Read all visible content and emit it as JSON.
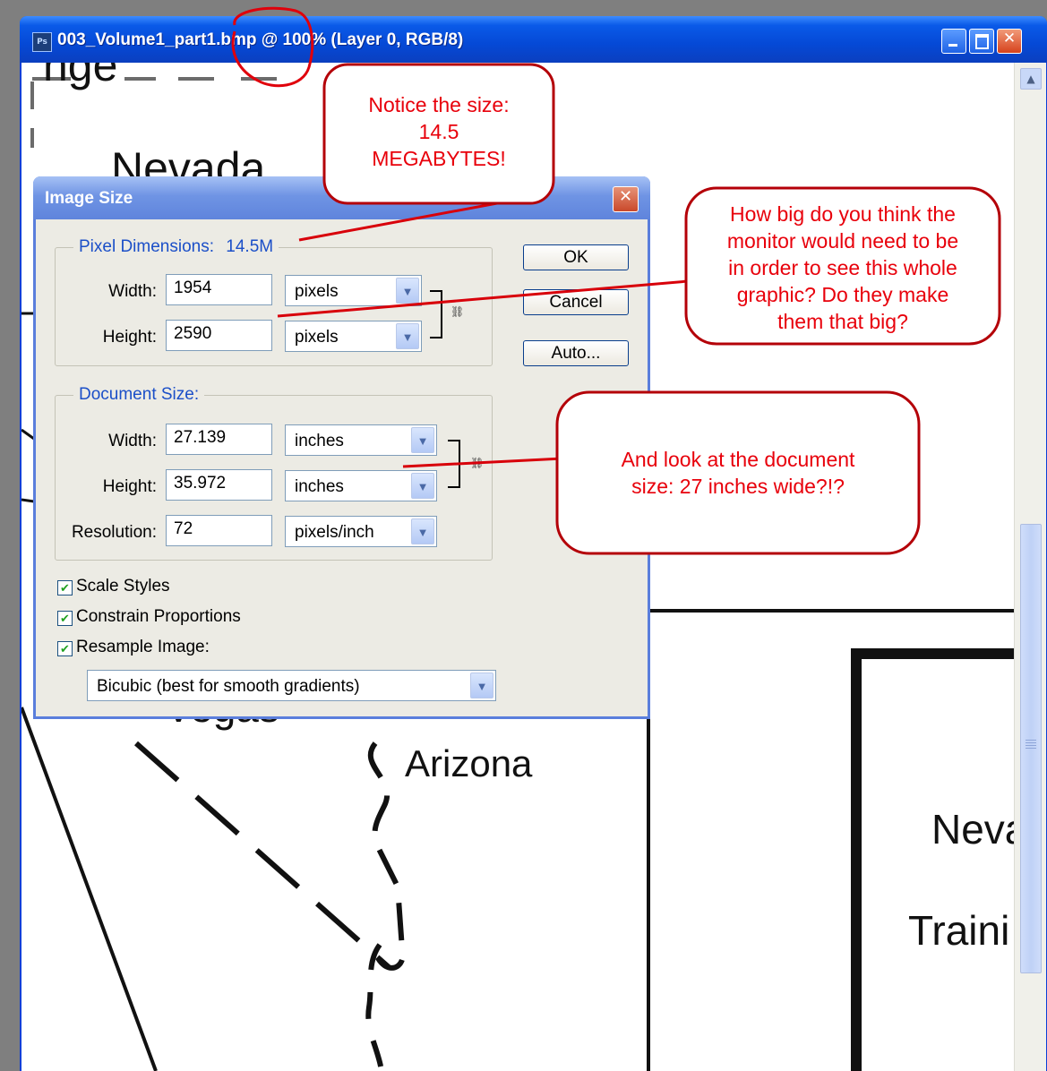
{
  "window": {
    "title": "003_Volume1_part1.bmp @ 100% (Layer 0, RGB/8)",
    "app_icon": "Ps",
    "controls": [
      "minimize",
      "maximize",
      "close"
    ],
    "colors": {
      "titlebar": "#0549d6",
      "canvas": "#ffffff"
    }
  },
  "map": {
    "labels": {
      "top_fragment": "nge",
      "nevada": "Nevada",
      "vegas_fragment": "Vegas",
      "arizona": "Arizona",
      "right_nevada": "Neva",
      "right_training": "Traini"
    }
  },
  "dialog": {
    "title": "Image Size",
    "pixel_dimensions": {
      "legend": "Pixel Dimensions:",
      "size": "14.5M",
      "width_label": "Width:",
      "width_value": "1954",
      "width_unit": "pixels",
      "height_label": "Height:",
      "height_value": "2590",
      "height_unit": "pixels"
    },
    "document_size": {
      "legend": "Document Size:",
      "width_label": "Width:",
      "width_value": "27.139",
      "width_unit": "inches",
      "height_label": "Height:",
      "height_value": "35.972",
      "height_unit": "inches",
      "resolution_label": "Resolution:",
      "resolution_value": "72",
      "resolution_unit": "pixels/inch"
    },
    "buttons": {
      "ok": "OK",
      "cancel": "Cancel",
      "auto": "Auto..."
    },
    "checkboxes": {
      "scale_styles": {
        "label": "Scale Styles",
        "checked": true
      },
      "constrain": {
        "label": "Constrain Proportions",
        "checked": true
      },
      "resample": {
        "label": "Resample Image:",
        "checked": true
      }
    },
    "resample_method": "Bicubic (best for smooth gradients)"
  },
  "annotations": {
    "callout_size": [
      "Notice the size:",
      "14.5",
      "MEGABYTES!"
    ],
    "callout_monitor": [
      "How big do you think the",
      "monitor would need to be",
      "in order to see this whole",
      "graphic? Do they make",
      "them that big?"
    ],
    "callout_document": [
      "And look at the document",
      "size: 27 inches wide?!?"
    ],
    "color": "#e8000b"
  }
}
